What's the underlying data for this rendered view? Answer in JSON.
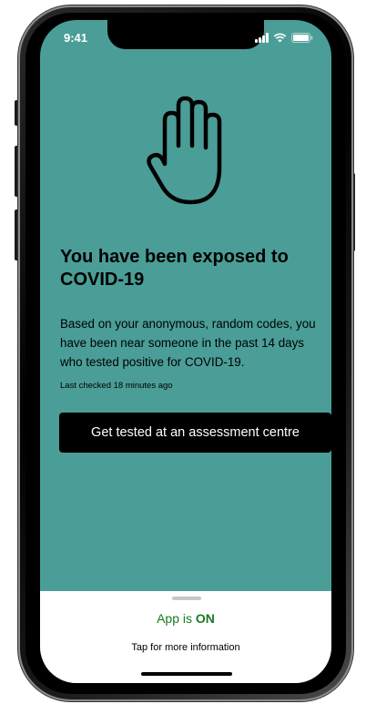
{
  "status_bar": {
    "time": "9:41"
  },
  "icons": {
    "hero": "hand-stop-icon",
    "signal": "signal-icon",
    "wifi": "wifi-icon",
    "battery": "battery-icon"
  },
  "alert": {
    "title": "You have been exposed to COVID-19",
    "body": "Based on your anonymous, random codes, you have been near someone in the past 14 days who tested positive for COVID-19.",
    "last_checked": "Last checked 18 minutes ago",
    "cta_label": "Get tested at an assessment centre"
  },
  "bottom_sheet": {
    "status_prefix": "App is ",
    "status_value": "ON",
    "info_link": "Tap for more information"
  },
  "colors": {
    "background": "#4a9e97",
    "button": "#000000",
    "button_text": "#ffffff",
    "status_on": "#1b7a20",
    "sheet": "#ffffff"
  }
}
